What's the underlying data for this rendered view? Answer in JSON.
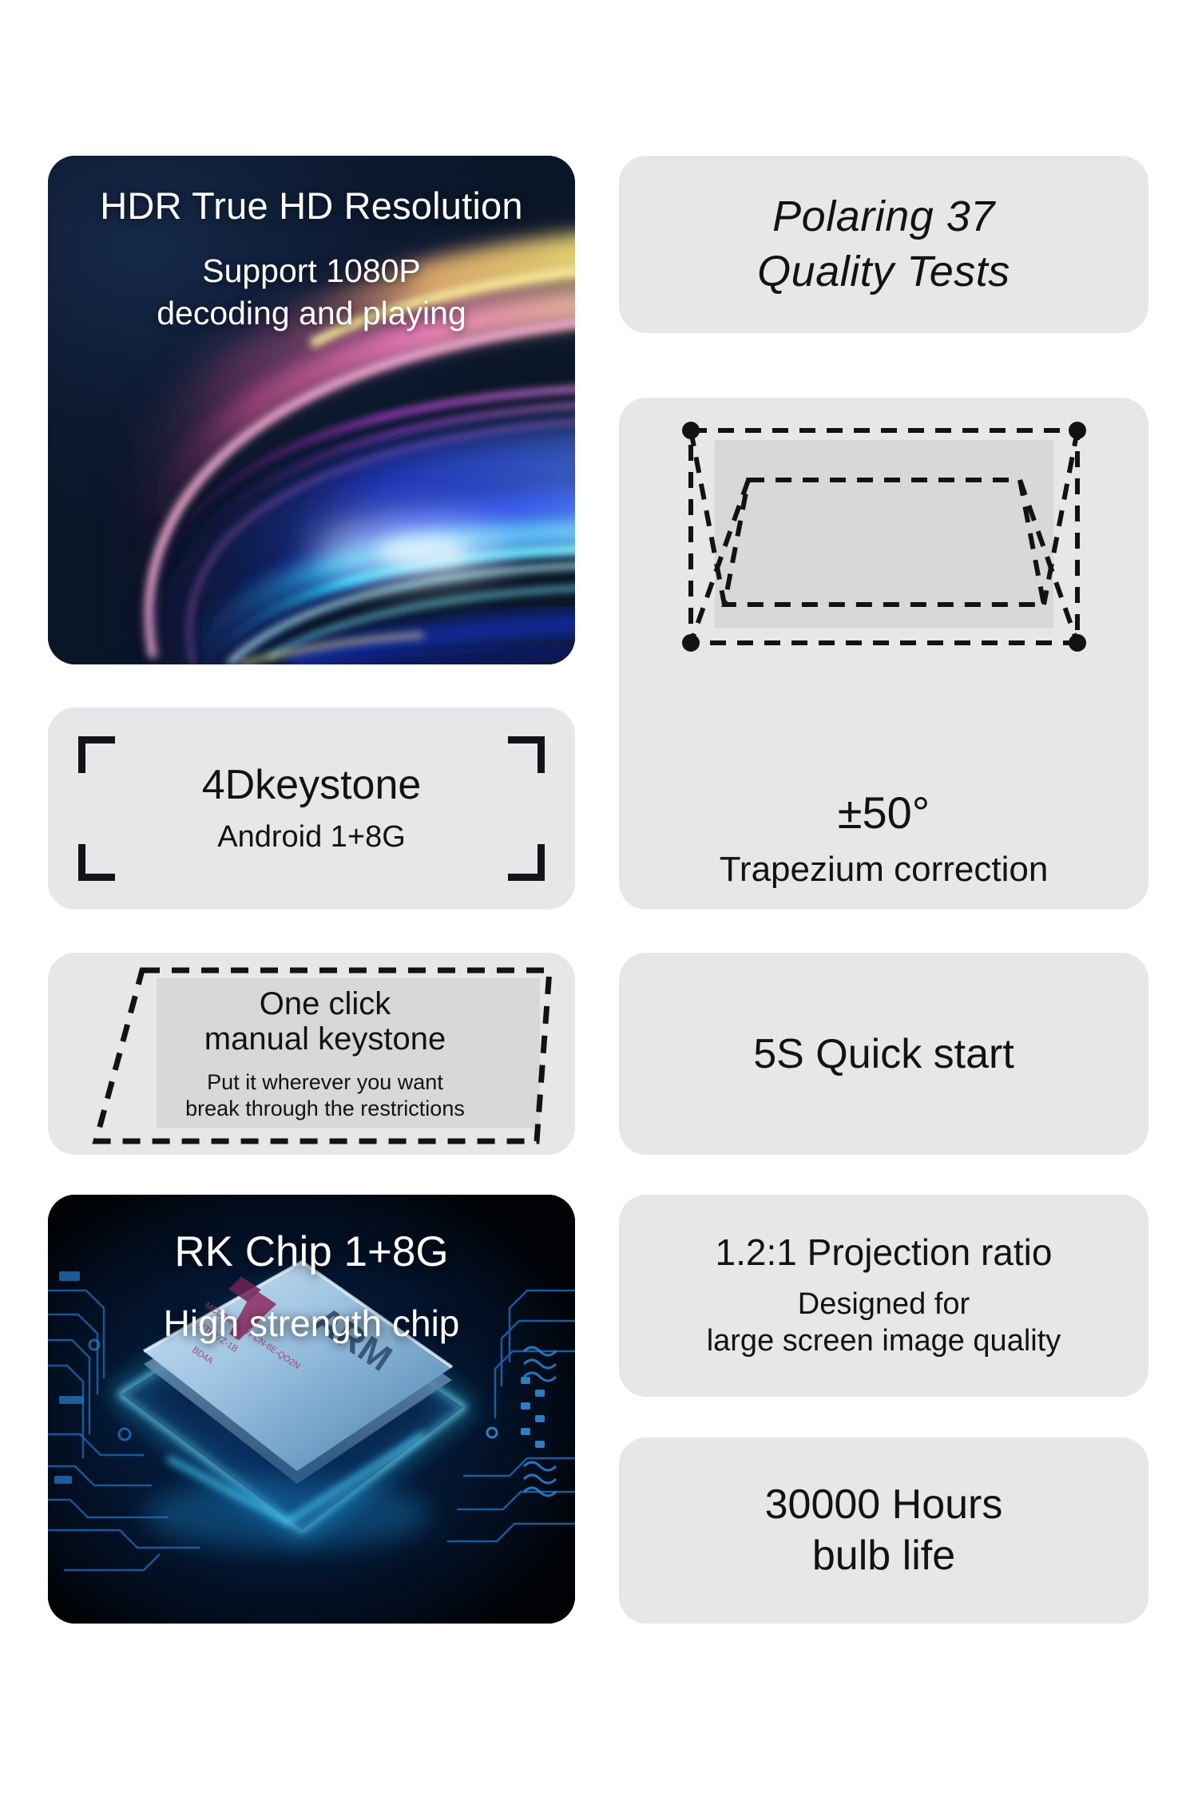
{
  "page": {
    "background": "#ffffff",
    "card_gray": "#e6e7e9",
    "card_inner_gray": "#dadbdd",
    "text_dark": "#111214",
    "text_light": "#ffffff",
    "navy": "#0d1b33"
  },
  "cards": {
    "hdr": {
      "title": "HDR True HD Resolution",
      "sub_line1": "Support 1080P",
      "sub_line2": "decoding and playing"
    },
    "polaring": {
      "line1": "Polaring 37",
      "line2": "Quality Tests"
    },
    "trapezium": {
      "angle": "±50°",
      "label": "Trapezium correction"
    },
    "keystone_4d": {
      "title": "4Dkeystone",
      "sub": "Android 1+8G"
    },
    "one_click": {
      "main_line1": "One click",
      "main_line2": "manual keystone",
      "sub_line1": "Put it wherever you want",
      "sub_line2": "break through the restrictions"
    },
    "rk_chip": {
      "title": "RK Chip 1+8G",
      "sub": "High strength chip",
      "chip_brand": "ARM"
    },
    "quick_start": {
      "label": "5S Quick start"
    },
    "projection_ratio": {
      "main": "1.2:1 Projection ratio",
      "sub_line1": "Designed for",
      "sub_line2": "large screen image quality"
    },
    "bulb_life": {
      "line1": "30000 Hours",
      "line2": "bulb life"
    }
  }
}
